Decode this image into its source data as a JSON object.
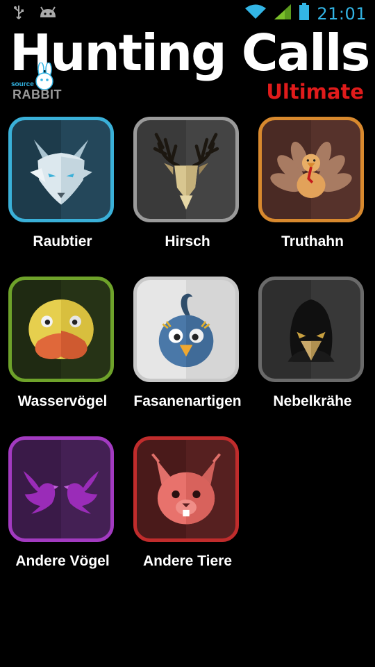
{
  "status_bar": {
    "time": "21:01",
    "icons": [
      "usb-icon",
      "android-icon",
      "wifi-icon",
      "signal-icon",
      "battery-icon"
    ],
    "accent": "#33b5e5"
  },
  "header": {
    "title": "Hunting Calls",
    "subtitle": "Ultimate",
    "subtitle_color": "#e01b1b",
    "logo": {
      "top_text": "source",
      "bottom_text": "RABBIT"
    }
  },
  "categories": [
    {
      "label": "Raubtier",
      "icon": "fox-icon",
      "border_color": "#3ab0d8"
    },
    {
      "label": "Hirsch",
      "icon": "deer-icon",
      "border_color": "#9a9a9a"
    },
    {
      "label": "Truthahn",
      "icon": "turkey-icon",
      "border_color": "#d8892e"
    },
    {
      "label": "Wasservögel",
      "icon": "duck-icon",
      "border_color": "#6ea22a"
    },
    {
      "label": "Fasanenartigen",
      "icon": "bird-icon",
      "border_color": "#c8c8c8"
    },
    {
      "label": "Nebelkrähe",
      "icon": "crow-icon",
      "border_color": "#6a6a6a"
    },
    {
      "label": "Andere Vögel",
      "icon": "doves-icon",
      "border_color": "#a23ac0"
    },
    {
      "label": "Andere Tiere",
      "icon": "squirrel-icon",
      "border_color": "#c02c2c"
    }
  ]
}
